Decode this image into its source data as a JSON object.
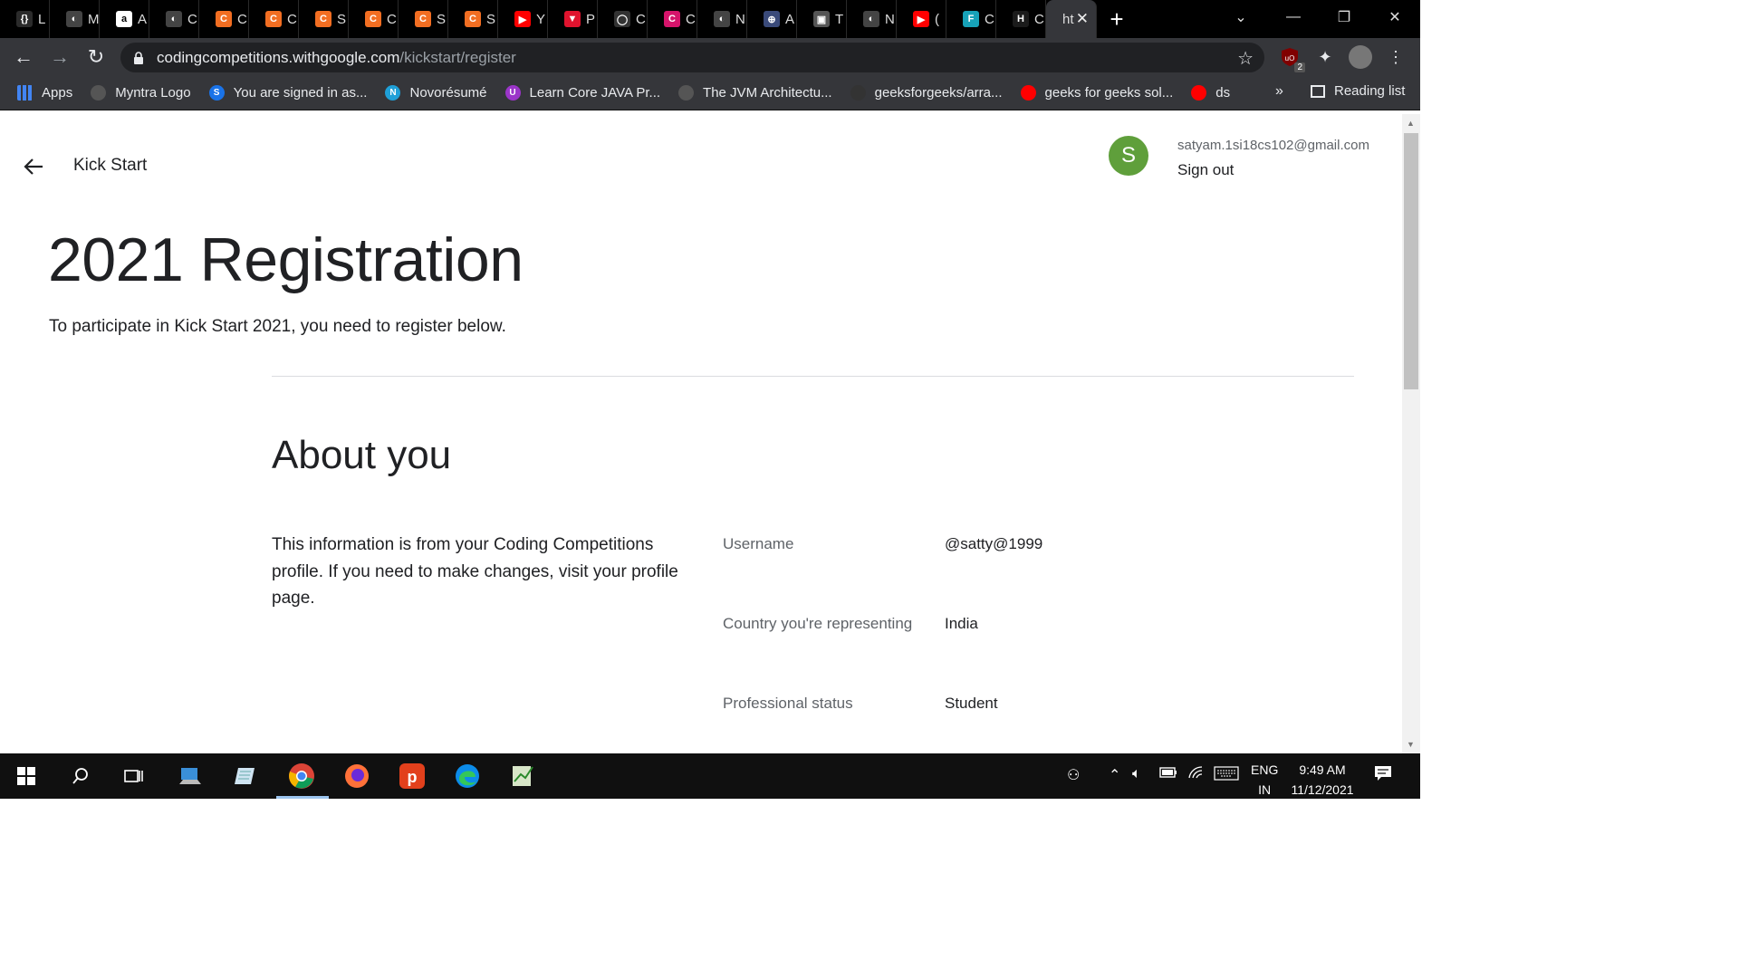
{
  "browser": {
    "tabs": [
      {
        "label": "L",
        "icon": "{}",
        "color": "#2b2b2b"
      },
      {
        "label": "M",
        "icon": "◐",
        "color": "#444"
      },
      {
        "label": "A",
        "icon": "a",
        "color": "#fff"
      },
      {
        "label": "C",
        "icon": "◐",
        "color": "#444"
      },
      {
        "label": "C",
        "icon": "C",
        "color": "#f26e22"
      },
      {
        "label": "C",
        "icon": "C",
        "color": "#f26e22"
      },
      {
        "label": "S",
        "icon": "C",
        "color": "#f26e22"
      },
      {
        "label": "C",
        "icon": "C",
        "color": "#f26e22"
      },
      {
        "label": "S",
        "icon": "C",
        "color": "#f26e22"
      },
      {
        "label": "S",
        "icon": "C",
        "color": "#f26e22"
      },
      {
        "label": "Y",
        "icon": "▶",
        "color": "#ff0000"
      },
      {
        "label": "P",
        "icon": "▼",
        "color": "#e0132e"
      },
      {
        "label": "C",
        "icon": "◯",
        "color": "#333"
      },
      {
        "label": "C",
        "icon": "C",
        "color": "#d6146b"
      },
      {
        "label": "N",
        "icon": "◐",
        "color": "#444"
      },
      {
        "label": "A",
        "icon": "⊕",
        "color": "#3a4a7a"
      },
      {
        "label": "T",
        "icon": "▣",
        "color": "#555"
      },
      {
        "label": "N",
        "icon": "◐",
        "color": "#444"
      },
      {
        "label": "(",
        "icon": "▶",
        "color": "#ff0000"
      },
      {
        "label": "C",
        "icon": "F",
        "color": "#17a2b8"
      },
      {
        "label": "C",
        "icon": "H",
        "color": "#1b1b1b"
      }
    ],
    "active_tab": {
      "label": "ht"
    },
    "url_domain": "codingcompetitions.withgoogle.com",
    "url_path": "/kickstart/register",
    "bookmarks": [
      {
        "label": "Apps",
        "icon": "grid-icon",
        "color": "#e44"
      },
      {
        "label": "Myntra Logo",
        "icon": "globe-icon",
        "color": "#555"
      },
      {
        "label": "You are signed in as...",
        "icon": "S",
        "color": "#1a73e8"
      },
      {
        "label": "Novorésumé",
        "icon": "N",
        "color": "#1fa0d8"
      },
      {
        "label": "Learn Core JAVA Pr...",
        "icon": "U",
        "color": "#9b35c9"
      },
      {
        "label": "The JVM Architectu...",
        "icon": "hex-icon",
        "color": "#555"
      },
      {
        "label": "geeksforgeeks/arra...",
        "icon": "github-icon",
        "color": "#333"
      },
      {
        "label": "geeks for geeks sol...",
        "icon": "youtube-icon",
        "color": "#ff0000"
      },
      {
        "label": "ds",
        "icon": "youtube-icon",
        "color": "#ff0000"
      }
    ],
    "reading_list": "Reading list",
    "ext_badge": "2"
  },
  "page": {
    "brand": "Kick Start",
    "user_initial": "S",
    "email": "satyam.1si18cs102@gmail.com",
    "sign_out": "Sign out",
    "title": "2021 Registration",
    "subtitle": "To participate in Kick Start 2021, you need to register below.",
    "section_title": "About you",
    "info": "This information is from your Coding Competitions profile. If you need to make changes, visit your profile page.",
    "fields": [
      {
        "label": "Username",
        "value": "@satty@1999"
      },
      {
        "label": "Country you're representing",
        "value": "India"
      },
      {
        "label": "Professional status",
        "value": "Student"
      }
    ]
  },
  "taskbar": {
    "lang_top": "ENG",
    "lang_bottom": "IN",
    "time": "9:49 AM",
    "date": "11/12/2021"
  }
}
